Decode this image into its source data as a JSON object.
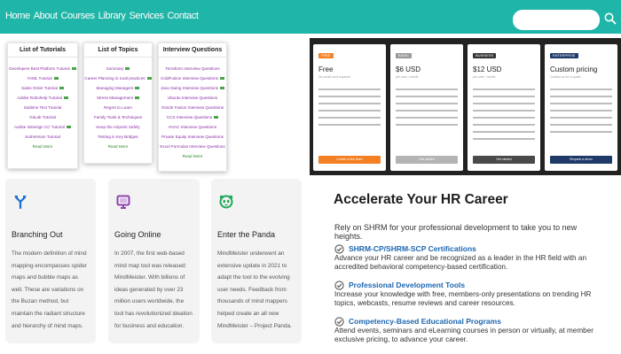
{
  "nav": {
    "items": [
      "Home",
      "About",
      "Courses",
      "Library",
      "Services",
      "Contact"
    ],
    "search": {
      "placeholder": "",
      "icon": "search-icon"
    },
    "color": "#1fb5a8"
  },
  "tutorials": {
    "cards": [
      {
        "title": "List of Tutorials",
        "items": [
          "Developers Best Platform Tutorial",
          "YAML Tutorial",
          "Sales Order Tutorial",
          "Adobe Robohelp Tutorial",
          "Sublime Text Tutorial",
          "GitLab Tutorial",
          "Adobe InDesign CC Tutorial",
          "SubVersion Tutorial"
        ],
        "read_more": "Read More"
      },
      {
        "title": "List of Topics",
        "items": [
          "Summary",
          "Career Planning in rural practices",
          "Managing Managers",
          "Stress Management",
          "Regret to Learn",
          "Family Tools & Techniques",
          "Keep the Airports Safely",
          "Testing in Key Bridges"
        ],
        "read_more": "Read More"
      },
      {
        "title": "Interview Questions",
        "items": [
          "Terraform Interview Questions",
          "ColdFusion Interview Questions",
          "Java Swing Interview Questions",
          "Ubuntu Interview Questions",
          "Oracle Fusion Interview Questions",
          "CCS Interview Questions",
          "HVAC Interview Questions",
          "Private Equity Interview Questions",
          "Excel Formulas Interview Questions"
        ],
        "read_more": "Read More"
      }
    ]
  },
  "pricing": {
    "plans": [
      {
        "tag": "FREE",
        "price": "Free",
        "subtitle": "No credit card required",
        "button": "Create a free team",
        "tag_color": "#f48024",
        "button_color": "#f48024"
      },
      {
        "tag": "BASIC",
        "price": "$6 USD",
        "subtitle": "per user / month",
        "button": "Get started",
        "tag_color": "#999999",
        "button_color": "#b4b4b4"
      },
      {
        "tag": "BUSINESS",
        "price": "$12 USD",
        "subtitle": "per user / month",
        "button": "Get started",
        "tag_color": "#333333",
        "button_color": "#4a4a4a"
      },
      {
        "tag": "ENTERPRISE",
        "price": "Custom pricing",
        "subtitle": "Contact us for a quote",
        "button": "Request a demo",
        "tag_color": "#1f3a68",
        "button_color": "#1f3a68"
      }
    ]
  },
  "features": [
    {
      "icon": "branch-icon",
      "title": "Branching Out",
      "body": "The modern definition of mind mapping encompasses spider maps and bubble maps as well. These are variations on the Buzan method, but maintain the radiant structure and hierarchy of mind maps.",
      "icon_color": "#1c6fd1"
    },
    {
      "icon": "monitor-icon",
      "title": "Going Online",
      "body": "In 2007, the first web-based mind map tool was released: MindMeister. With billions of ideas generated by over 23 million users worldwide, the tool has revolutionized ideation for business and education.",
      "icon_color": "#8e44ad"
    },
    {
      "icon": "panda-icon",
      "title": "Enter the Panda",
      "body": "MindMeister underwent an extensive update in 2021 to adapt the tool to the evolving user needs. Feedback from thousands of mind mappers helped create an all new MindMeister – Project Panda.",
      "icon_color": "#21a85a"
    }
  ],
  "hr": {
    "title": "Accelerate Your HR Career",
    "intro": "Rely on SHRM for your professional development to take you to new heights.",
    "items": [
      {
        "title": "SHRM-CP/SHRM-SCP Certifications",
        "desc": "Advance your HR career and be recognized as a leader in the HR field with an accredited behavioral competency-based certification."
      },
      {
        "title": "Professional Development Tools",
        "desc": "Increase your knowledge with free, members-only presentations on trending HR topics, webcasts, resume reviews and career resources."
      },
      {
        "title": "Competency-Based Educational Programs",
        "desc": "Attend events, seminars and eLearning courses in person or virtually, at member exclusive pricing, to advance your career."
      }
    ],
    "accent": "#1d66b0"
  }
}
